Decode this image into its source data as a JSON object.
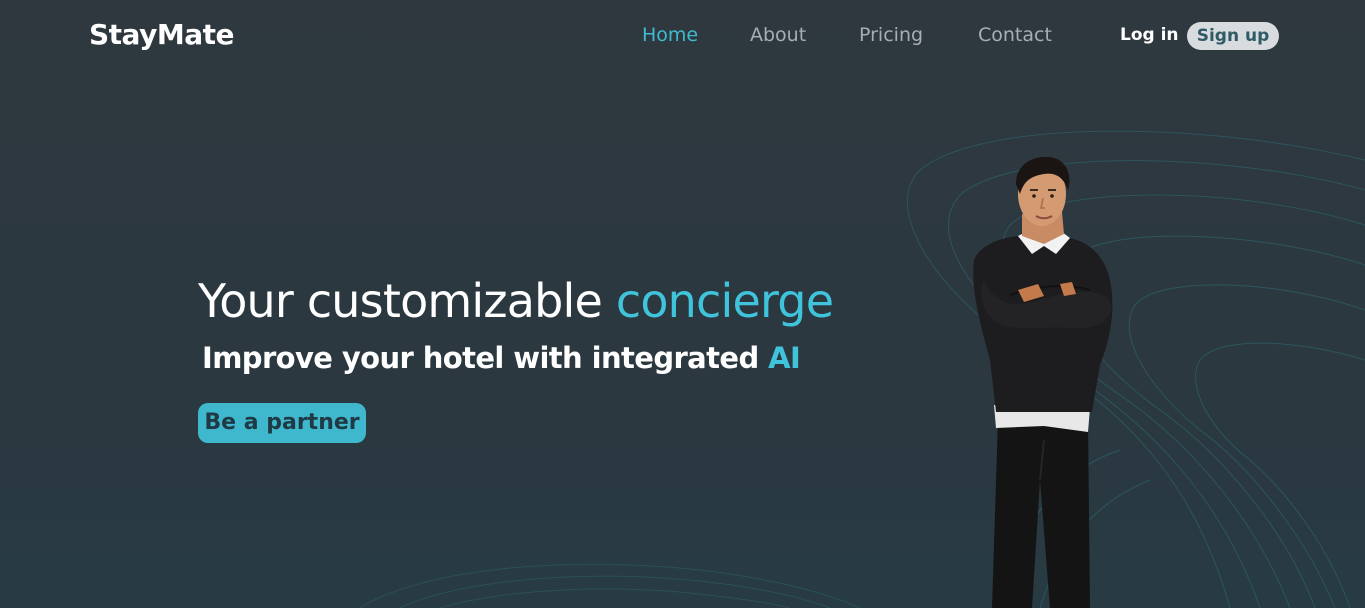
{
  "header": {
    "logo": "StayMate",
    "nav": [
      {
        "label": "Home",
        "active": true
      },
      {
        "label": "About",
        "active": false
      },
      {
        "label": "Pricing",
        "active": false
      },
      {
        "label": "Contact",
        "active": false
      }
    ],
    "login_label": "Log in",
    "signup_label": "Sign up"
  },
  "hero": {
    "title_main": "Your customizable ",
    "title_accent": "concierge",
    "subtitle_main": "Improve your hotel with integrated ",
    "subtitle_accent": "AI",
    "cta_label": "Be a partner"
  },
  "colors": {
    "background": "#2c353d",
    "accent": "#3fc4dc",
    "button": "#3fb8ce",
    "nav_inactive": "#a7aeb4"
  },
  "icons": {
    "avatar": "concierge-avatar-illustration"
  }
}
